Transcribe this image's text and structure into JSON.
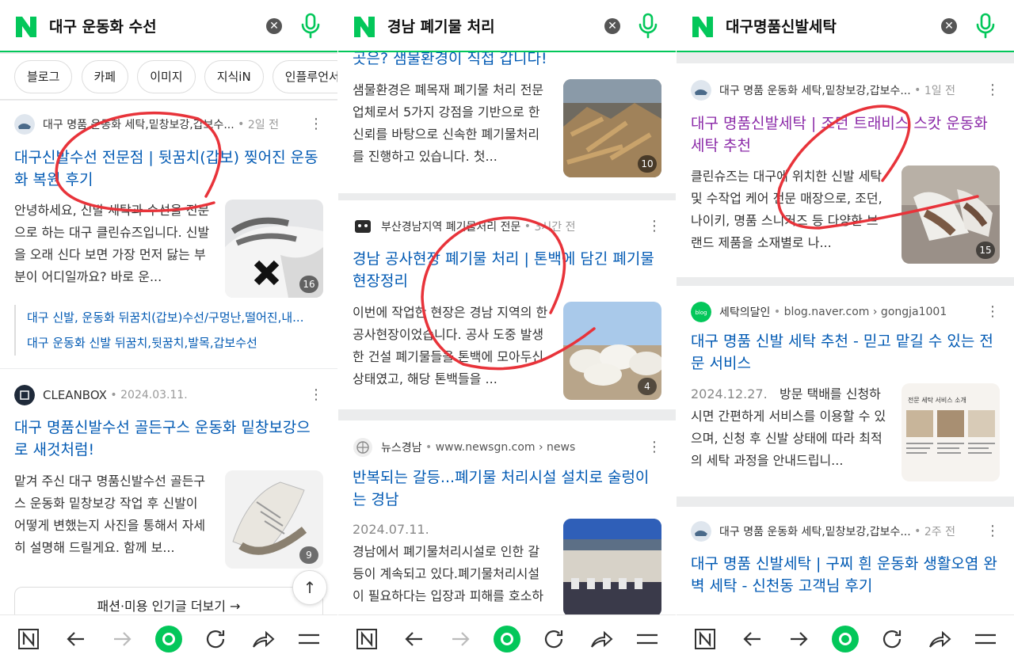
{
  "panel1": {
    "query": "대구 운동화 수선",
    "chips": [
      "블로그",
      "카페",
      "이미지",
      "지식iN",
      "인플루언서"
    ],
    "results": [
      {
        "source": "대구 명품 운동화 세탁,밑창보강,갑보수...",
        "meta": "2일 전",
        "title": "대구신발수선 전문점 | 뒷꿈치(갑보) 찢어진 운동화 복원 후기",
        "body": "안녕하세요, 신발 세탁과 수선을 전문으로 하는 대구 클린슈즈입니다. 신발을 오래 신다 보면 가장 먼저 닳는 부분이 어디일까요? 바로 운...",
        "count": "16",
        "sublinks": [
          "대구 신발, 운동화 뒤꿈치(갑보)수선/구멍난,떨어진,내...",
          "대구 운동화 신발 뒤꿈치,뒷꿈치,발목,갑보수선"
        ]
      },
      {
        "source": "CLEANBOX",
        "meta": "2024.03.11.",
        "title": "대구 명품신발수선 골든구스 운동화 밑창보강으로 새것처럼!",
        "body": "맡겨 주신 대구 명품신발수선 골든구스 운동화 밑창보강 작업 후 신발이 어떻게 변했는지 사진을 통해서 자세히 설명해 드릴게요. 함께 보...",
        "count": "9"
      }
    ],
    "more": "패션·미용 인기글 더보기 →"
  },
  "panel2": {
    "query": "경남 폐기물 처리",
    "results": [
      {
        "title": "곳은? 샘물환경이 직접 갑니다!",
        "body": "샘물환경은 폐목재 폐기물 처리 전문 업체로서 5가지 강점을 기반으로 한 신뢰를 바탕으로 신속한 폐기물처리를 진행하고 있습니다. 첫...",
        "count": "10"
      },
      {
        "source": "부산경남지역 폐기물처리 전문",
        "meta": "3시간 전",
        "title": "경남 공사현장 폐기물 처리 | 톤백에 담긴 폐기물 현장정리",
        "body": "이번에 작업한 현장은 경남 지역의 한 공사현장이었습니다. 공사 도중 발생한 건설 폐기물들을 톤백에 모아두신 상태였고, 해당 톤백들을 ...",
        "count": "4"
      },
      {
        "source": "뉴스경남",
        "meta": "www.newsgn.com › news",
        "title": "반복되는 갈등...폐기물 처리시설 설치로 술렁이는 경남",
        "date": "2024.07.11.",
        "body": "경남에서 폐기물처리시설로 인한 갈등이 계속되고 있다.폐기물처리시설이 필요하다는 입장과 피해를 호소하는 주민간..."
      }
    ]
  },
  "panel3": {
    "query": "대구명품신발세탁",
    "results": [
      {
        "source": "대구 명품 운동화 세탁,밑창보강,갑보수...",
        "meta": "1일 전",
        "title": "대구 명품신발세탁 | 조던 트래비스 스캇 운동화 세탁 추천",
        "body": "클린슈즈는 대구에 위치한 신발 세탁 및 수작업 케어 전문 매장으로, 조던, 나이키, 명품 스니커즈 등 다양한 브랜드 제품을 소재별로 나...",
        "count": "15"
      },
      {
        "source": "세탁의달인",
        "meta": "blog.naver.com › gongja1001",
        "title": "대구 명품 신발 세탁 추천 - 믿고 맡길 수 있는 전문 서비스",
        "date": "2024.12.27.",
        "body": "방문 택배를 신청하시면 간편하게 서비스를 이용할 수 있으며, 신청 후 신발 상태에 따라 최적의 세탁 과정을 안내드립니...",
        "thumb_title": "전문 세탁 서비스 소개"
      },
      {
        "source": "대구 명품 운동화 세탁,밑창보강,갑보수...",
        "meta": "2주 전",
        "title": "대구 명품 신발세탁 | 구찌 흰 운동화 생활오염 완벽 세탁 - 신천동 고객님 후기"
      }
    ]
  },
  "colors": {
    "naver_green": "#03c75a",
    "link_blue": "#0059b3",
    "visited_purple": "#8b2aa8",
    "annotation_red": "#e8333a"
  },
  "icons": [
    "naver-logo-icon",
    "clear-icon",
    "mic-icon",
    "more-dots-icon",
    "scroll-top-icon",
    "home-n-icon",
    "back-icon",
    "forward-icon",
    "green-dot-icon",
    "refresh-icon",
    "share-icon",
    "menu-icon"
  ]
}
